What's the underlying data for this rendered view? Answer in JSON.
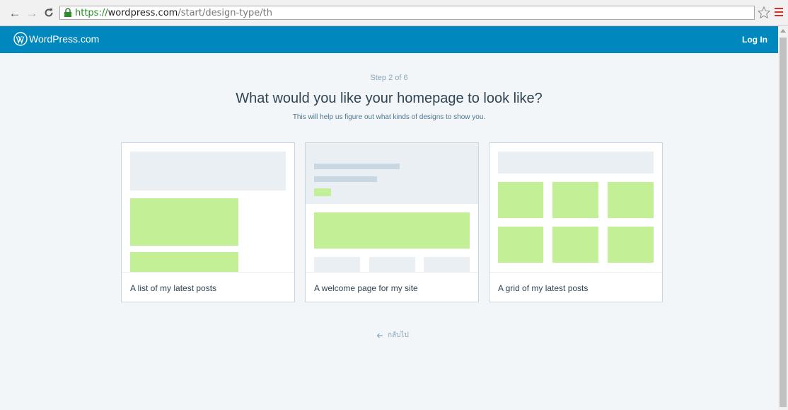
{
  "browser": {
    "url_scheme": "https://",
    "url_host": "wordpress.com",
    "url_path": "/start/design-type/th"
  },
  "masterbar": {
    "brand": "WordPress.com",
    "login_label": "Log In"
  },
  "header": {
    "step": "Step 2 of 6",
    "title": "What would you like your homepage to look like?",
    "subtitle": "This will help us figure out what kinds of designs to show you."
  },
  "options": [
    {
      "label": "A list of my latest posts"
    },
    {
      "label": "A welcome page for my site"
    },
    {
      "label": "A grid of my latest posts"
    }
  ],
  "back_label": "กลับไป",
  "colors": {
    "masterbar": "#0087be",
    "background": "#f3f6f8",
    "placeholder_green": "#c3ef96",
    "placeholder_gray": "#e9eff3"
  }
}
